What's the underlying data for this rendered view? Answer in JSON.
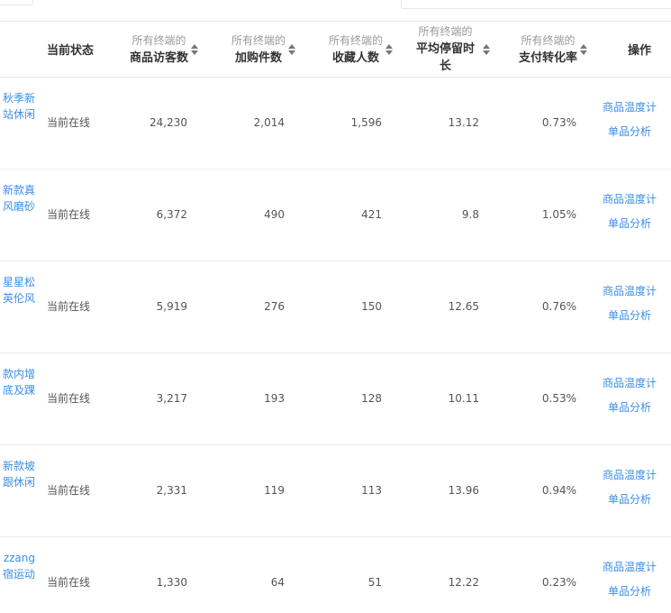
{
  "header": {
    "status_label": "当前状态",
    "op_label": "操作",
    "columns": [
      {
        "sub": "所有终端的",
        "main": "商品访客数"
      },
      {
        "sub": "所有终端的",
        "main": "加购件数"
      },
      {
        "sub": "所有终端的",
        "main": "收藏人数"
      },
      {
        "sub": "所有终端的",
        "main": "平均停留时长"
      },
      {
        "sub": "所有终端的",
        "main": "支付转化率"
      }
    ]
  },
  "rows": [
    {
      "name_line1": "秋季新",
      "name_line2": "站休闲",
      "status": "当前在线",
      "visitors": "24,230",
      "cart": "2,014",
      "fav": "1,596",
      "stay": "13.12",
      "conv": "0.73%",
      "op1": "商品温度计",
      "op2": "单品分析"
    },
    {
      "name_line1": "新款真",
      "name_line2": "风磨砂",
      "status": "当前在线",
      "visitors": "6,372",
      "cart": "490",
      "fav": "421",
      "stay": "9.8",
      "conv": "1.05%",
      "op1": "商品温度计",
      "op2": "单品分析"
    },
    {
      "name_line1": "星星松",
      "name_line2": "英伦风",
      "status": "当前在线",
      "visitors": "5,919",
      "cart": "276",
      "fav": "150",
      "stay": "12.65",
      "conv": "0.76%",
      "op1": "商品温度计",
      "op2": "单品分析"
    },
    {
      "name_line1": "款内增",
      "name_line2": "底及踝",
      "status": "当前在线",
      "visitors": "3,217",
      "cart": "193",
      "fav": "128",
      "stay": "10.11",
      "conv": "0.53%",
      "op1": "商品温度计",
      "op2": "单品分析"
    },
    {
      "name_line1": "新款坡",
      "name_line2": "跟休闲",
      "status": "当前在线",
      "visitors": "2,331",
      "cart": "119",
      "fav": "113",
      "stay": "13.96",
      "conv": "0.94%",
      "op1": "商品温度计",
      "op2": "单品分析"
    },
    {
      "name_line1": "zzang",
      "name_line2": "宿运动",
      "status": "当前在线",
      "visitors": "1,330",
      "cart": "64",
      "fav": "51",
      "stay": "12.22",
      "conv": "0.23%",
      "op1": "商品温度计",
      "op2": "单品分析"
    }
  ]
}
